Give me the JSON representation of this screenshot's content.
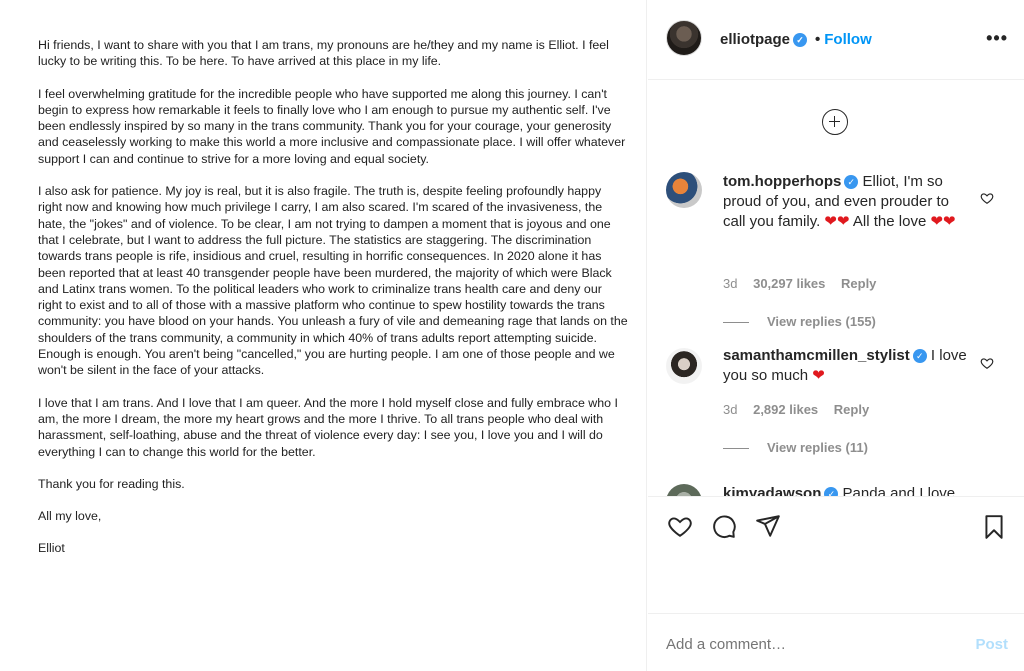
{
  "letter": {
    "p1": "Hi friends, I want to share with you that I am trans, my pronouns are he/they and my name is Elliot. I feel lucky to be writing this. To be here. To have arrived at this place in my life.",
    "p2": "I feel overwhelming gratitude for the incredible people who have supported me along this journey. I can't begin to express how remarkable it feels to finally love who I am enough to pursue my authentic self. I've been endlessly inspired by so many in the trans community. Thank you for your courage, your generosity and ceaselessly working to make this world a more inclusive and compassionate place. I will offer whatever support I can and continue to strive for a more loving and equal society.",
    "p3": "I also ask for patience. My joy is real, but it is also fragile. The truth is, despite feeling profoundly happy right now and knowing how much privilege I carry, I am also scared. I'm scared of the invasiveness, the hate, the \"jokes\" and of violence. To be clear, I am not trying to dampen a moment that is joyous and one that I celebrate, but I want to address the full picture. The statistics are staggering. The discrimination towards trans people is rife, insidious and cruel, resulting in horrific consequences. In 2020 alone it has been reported that at least 40 transgender people have been murdered, the majority of which were Black and Latinx trans women. To the political leaders who work to criminalize trans health care and deny our right to exist and to all of those with a massive platform who continue to spew hostility towards the trans community: you have blood on your hands. You unleash a fury of vile and demeaning rage that lands on the shoulders of the trans community, a community in which 40% of trans adults report attempting suicide. Enough is enough. You aren't being \"cancelled,\" you are hurting people. I am one of those people and we won't be silent in the face of your attacks.",
    "p4": "I love that I am trans. And I love that I am queer. And the more I hold myself close and fully embrace who I am, the more I dream, the more my heart grows and the more I thrive. To all trans people who deal with harassment, self-loathing, abuse and the threat of violence every day: I see you, I love you and I will do everything I can to change this world for the better.",
    "p5": "Thank you for reading this.",
    "p6": "All my love,",
    "p7": "Elliot"
  },
  "header": {
    "username": "elliotpage",
    "verified_glyph": "✓",
    "dot": "•",
    "follow_label": "Follow",
    "more_label": "•••"
  },
  "comments": [
    {
      "user": "tom.hopperhops",
      "text_a": "Elliot, I'm so proud of you, and even prouder to call you family. ",
      "hearts_a": "❤❤",
      "text_b": "All the love ",
      "hearts_b": "❤❤",
      "time": "3d",
      "likes": "30,297 likes",
      "reply": "Reply",
      "view_replies": "View replies (155)"
    },
    {
      "user": "samanthamcmillen_stylist",
      "text_a": "I love you so much ",
      "hearts_a": "❤",
      "time": "3d",
      "likes": "2,892 likes",
      "reply": "Reply",
      "view_replies": "View replies (11)"
    },
    {
      "user": "kimyadawson",
      "text_a": "Panda and I love"
    }
  ],
  "add_comment_placeholder": "Add a comment…",
  "post_label": "Post",
  "colors": {
    "accent": "#0095f6",
    "verified": "#3897f0",
    "heart": "#e0191e",
    "muted": "#8e8e8e"
  }
}
